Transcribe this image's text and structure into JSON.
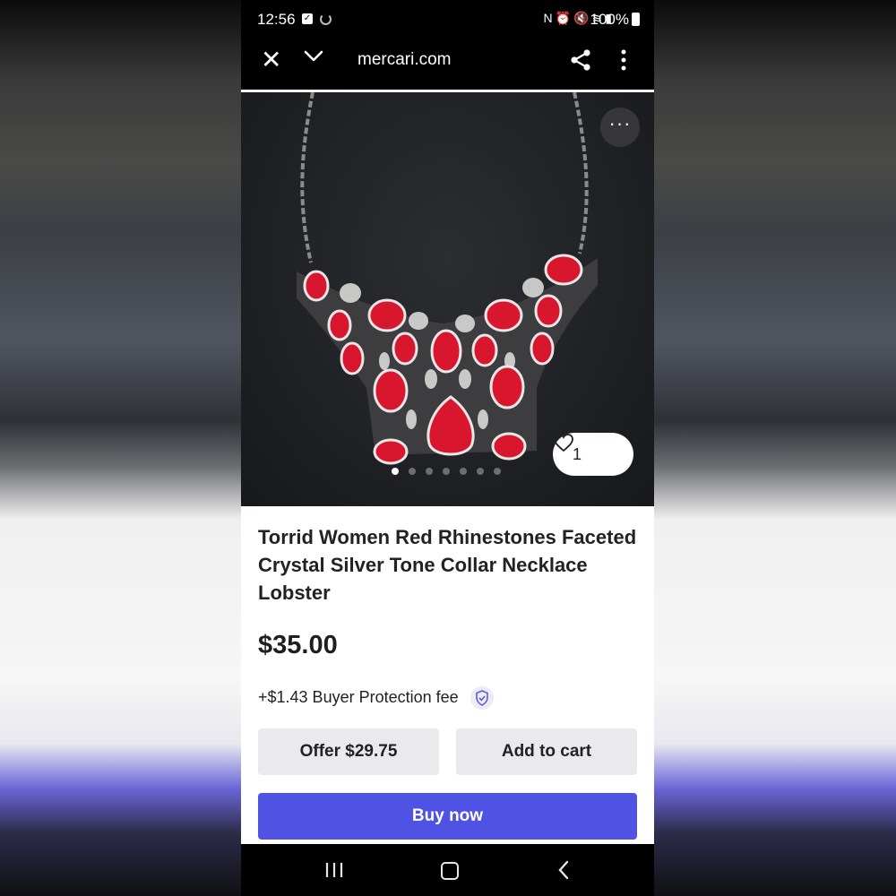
{
  "status_bar": {
    "time": "12:56",
    "icons": [
      "nfc-icon",
      "alarm-icon",
      "mute-icon",
      "wifi-icon",
      "signal-icon"
    ],
    "battery": "100%"
  },
  "browser": {
    "url": "mercari.com",
    "icons": [
      "close-icon",
      "chevron-down-icon",
      "share-icon",
      "more-vertical-icon"
    ]
  },
  "product": {
    "image_dot_count": 7,
    "active_image_index": 0,
    "like_count": "1",
    "title": "Torrid Women Red Rhinestones Faceted Crystal Silver Tone Collar Necklace Lobster",
    "price": "$35.00",
    "fee": "+$1.43 Buyer Protection fee"
  },
  "actions": {
    "offer_label": "Offer $29.75",
    "cart_label": "Add to cart",
    "buy_label": "Buy now"
  },
  "colors": {
    "accent": "#4f52e3",
    "secondary_button": "#eaeaec",
    "bar": "#000000"
  }
}
